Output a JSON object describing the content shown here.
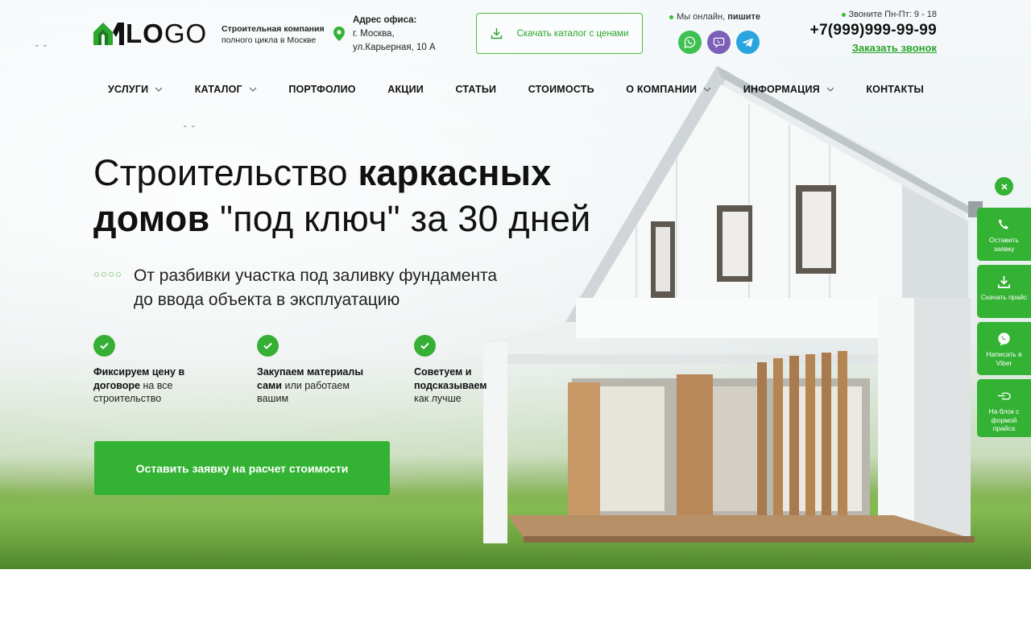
{
  "logo": {
    "bold": "LO",
    "regular": "GO"
  },
  "tagline": {
    "line1": "Строительная компания",
    "line2": "полного цикла в Москве"
  },
  "address": {
    "heading": "Адрес офиса:",
    "line1": "г. Москва,",
    "line2": "ул.Карьерная, 10 А",
    "icon": "map-pin-icon"
  },
  "catalog_button": {
    "label": "Скачать каталог с ценами",
    "icon": "download-icon"
  },
  "online": {
    "prefix": "Мы онлайн,",
    "action": "пишите"
  },
  "messengers": [
    "whatsapp-icon",
    "viber-icon",
    "telegram-icon"
  ],
  "contact": {
    "hours": "Звоните Пн-Пт: 9 - 18",
    "phone": "+7(999)999-99-99",
    "callback": "Заказать звонок"
  },
  "nav": [
    {
      "label": "УСЛУГИ",
      "dropdown": true
    },
    {
      "label": "КАТАЛОГ",
      "dropdown": true
    },
    {
      "label": "ПОРТФОЛИО",
      "dropdown": false
    },
    {
      "label": "АКЦИИ",
      "dropdown": false
    },
    {
      "label": "СТАТЬИ",
      "dropdown": false
    },
    {
      "label": "СТОИМОСТЬ",
      "dropdown": false
    },
    {
      "label": "О КОМПАНИИ",
      "dropdown": true
    },
    {
      "label": "ИНФОРМАЦИЯ",
      "dropdown": true
    },
    {
      "label": "КОНТАКТЫ",
      "dropdown": false
    }
  ],
  "hero": {
    "headline_1_regular": "Строительство ",
    "headline_1_bold": "каркасных",
    "headline_2_bold": "домов",
    "headline_2_regular": " \"под ключ\" за 30 дней",
    "subtitle_1": "От разбивки участка под заливку фундамента",
    "subtitle_2": "до ввода объекта в эксплуатацию"
  },
  "features": [
    {
      "bold": "Фиксируем цену в договоре",
      "regular": " на все строительство"
    },
    {
      "bold": "Закупаем материалы сами",
      "regular": " или работаем вашим"
    },
    {
      "bold": "Советуем и подсказываем",
      "regular": " как лучше"
    }
  ],
  "cta": {
    "label": "Оставить заявку на расчет стоимости"
  },
  "side_widgets": [
    {
      "label": "Оставить заявку",
      "icon": "phone-icon"
    },
    {
      "label": "Скачать прайс",
      "icon": "download-icon"
    },
    {
      "label": "Написать в Viber",
      "icon": "viber-icon"
    },
    {
      "label": "На блок с формой прайса",
      "icon": "pointing-hand-icon"
    }
  ],
  "colors": {
    "accent": "#33b233",
    "text": "#111111"
  }
}
